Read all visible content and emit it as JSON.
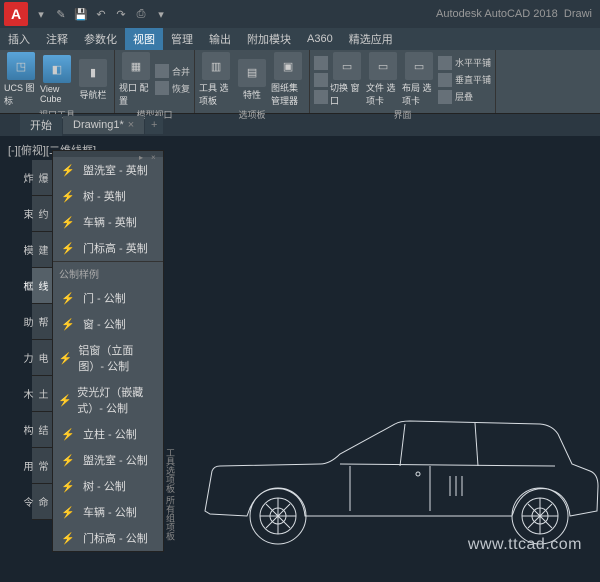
{
  "title": {
    "app": "Autodesk AutoCAD 2018",
    "doc": "Drawi"
  },
  "menu": {
    "items": [
      "插入",
      "注释",
      "参数化",
      "视图",
      "管理",
      "输出",
      "附加模块",
      "A360",
      "精选应用"
    ]
  },
  "ribbon": {
    "groups": [
      {
        "label": "视口工具",
        "big": [
          {
            "name": "ucs",
            "label": "UCS\n图标"
          },
          {
            "name": "viewcube",
            "label": "View\nCube"
          },
          {
            "name": "navbar",
            "label": "导航栏"
          }
        ]
      },
      {
        "label": "模型视口",
        "big": [
          {
            "name": "vpcfg",
            "label": "视口\n配置"
          }
        ],
        "small": [
          {
            "label": "合并"
          },
          {
            "label": "恢复"
          }
        ]
      },
      {
        "label": "选项板",
        "big": [
          {
            "name": "tp",
            "label": "工具\n选项板"
          }
        ],
        "small": [
          {
            "label": "特性"
          },
          {
            "label": "图纸集\n管理器"
          }
        ]
      },
      {
        "label": "",
        "small2": [
          {
            "label": ""
          },
          {
            "label": ""
          },
          {
            "label": ""
          }
        ],
        "big": [
          {
            "name": "sw",
            "label": "切换\n窗口"
          },
          {
            "name": "ft",
            "label": "文件\n选项卡"
          },
          {
            "name": "lt",
            "label": "布局\n选项卡"
          }
        ]
      },
      {
        "label": "界面",
        "small": [
          {
            "label": "水平平铺"
          },
          {
            "label": "垂直平铺"
          },
          {
            "label": "层叠"
          }
        ]
      }
    ]
  },
  "filetabs": {
    "items": [
      "开始",
      "Drawing1*"
    ]
  },
  "viewport_label": "[-][俯视][二维线框]",
  "sidetabs": [
    "爆炸",
    "约束",
    "建模",
    "线框",
    "帮助",
    "电力",
    "土木",
    "结构",
    "常用",
    "命令"
  ],
  "palette": {
    "items1": [
      {
        "label": "盥洗室 - 英制"
      },
      {
        "label": "树 - 英制"
      },
      {
        "label": "车辆 - 英制"
      },
      {
        "label": "门标高 - 英制"
      }
    ],
    "sep": "公制样例",
    "items2": [
      {
        "label": "门 - 公制"
      },
      {
        "label": "窗 - 公制"
      },
      {
        "label": "铝窗（立面图）- 公制"
      },
      {
        "label": "荧光灯（嵌藏式）- 公制"
      },
      {
        "label": "立柱 - 公制"
      },
      {
        "label": "盥洗室 - 公制"
      },
      {
        "label": "树 - 公制"
      },
      {
        "label": "车辆 - 公制"
      },
      {
        "label": "门标高 - 公制"
      }
    ],
    "foot1": "工具选项板",
    "foot2": "所有组项板"
  },
  "watermark": "www.ttcad.com"
}
